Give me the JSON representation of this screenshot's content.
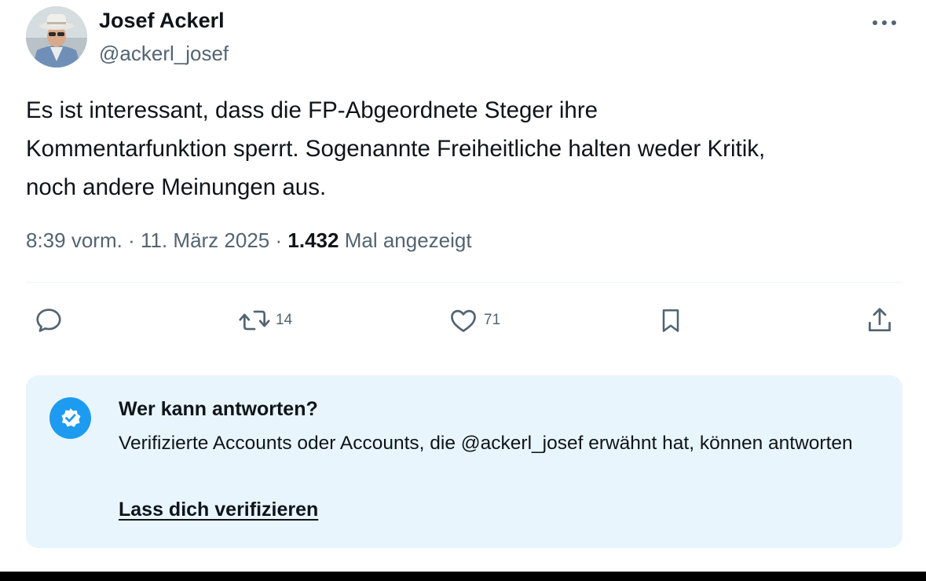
{
  "author": {
    "name": "Josef Ackerl",
    "handle": "@ackerl_josef",
    "avatar_icon": "profile-photo-man-with-hat"
  },
  "more_icon": "more-dots-icon",
  "tweet": {
    "text": "Es ist interessant, dass die FP-Abgeordnete Steger ihre\nKommentarfunktion sperrt. Sogenannte Freiheitliche halten weder Kritik,\nnoch andere Meinungen aus.",
    "time": "8:39 vorm.",
    "separator": "·",
    "date": "11. März 2025",
    "views_count": "1.432",
    "views_label": "Mal angezeigt"
  },
  "actions": {
    "reply": {
      "icon": "reply-icon",
      "count": ""
    },
    "retweet": {
      "icon": "retweet-icon",
      "count": "14"
    },
    "like": {
      "icon": "heart-icon",
      "count": "71"
    },
    "bookmark": {
      "icon": "bookmark-icon"
    },
    "share": {
      "icon": "share-icon"
    }
  },
  "reply_restriction": {
    "icon": "verified-badge-icon",
    "title": "Wer kann antworten?",
    "description": "Verifizierte Accounts oder Accounts, die @ackerl_josef erwähnt hat, können antworten",
    "link_label": "Lass dich verifizieren"
  },
  "colors": {
    "text_primary": "#0f1419",
    "text_secondary": "#536471",
    "accent_blue": "#1d9bf0",
    "info_background": "#e8f5fd",
    "divider": "#eff3f4"
  }
}
